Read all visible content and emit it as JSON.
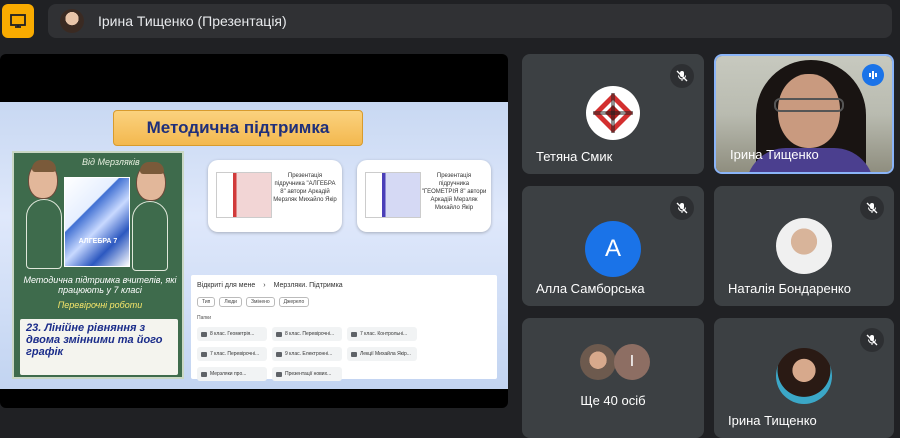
{
  "topbar": {
    "title": "Ірина Тищенко (Презентація)"
  },
  "slide": {
    "title": "Методична підтримка",
    "board_from": "Від Мерзляків",
    "book_label": "АЛГЕБРА 7",
    "board_text": "Методична підтримка вчителів, які працюють у 7 класі",
    "board_sub": "Перевірочні роботи",
    "note_text": "23. Лінійне рівняння з двома змінними та його графік",
    "card1_text": "Презентація підручника \"АЛГЕБРА 8\" автори Аркадій Мерзляк Михайло Якір",
    "card2_text": "Презентація підручника \"ГЕОМЕТРІЯ 8\" автори Аркадій Мерзляк Михайло Якір",
    "drive": {
      "shared": "Відкриті для мене",
      "folder": "Мерзляки. Підтримка",
      "chips": [
        "Тип",
        "Люди",
        "Змінено",
        "Джерело"
      ],
      "label": "Папки",
      "files": [
        "8 клас. Геометрія...",
        "8 клас. Перевірочні...",
        "7 клас. Контрольні...",
        "7 клас. Перевірочні...",
        "9 клас. Електронні...",
        "Лекції Михайла Якір...",
        "Мерзляки про...",
        "Презентації нових..."
      ]
    }
  },
  "participants": [
    {
      "name": "Тетяна Смик",
      "muted": true
    },
    {
      "name": "Ірина Тищенко",
      "speaking": true
    },
    {
      "name": "Алла Самборська",
      "initial": "А",
      "muted": true
    },
    {
      "name": "Наталія Бондаренко",
      "muted": true
    },
    {
      "name": "Ще 40 осіб",
      "extra_initial": "І"
    },
    {
      "name": "Ірина Тищенко",
      "muted": true
    }
  ],
  "colors": {
    "background": "#202124",
    "tile": "#3c4043",
    "accent": "#f9ab00",
    "avatar_blue": "#1a73e8",
    "avatar_brown": "#8d6e63",
    "active_border": "#8ab4f8"
  },
  "icons": {
    "app": "presentation-icon",
    "mute": "mic-off-icon",
    "speaking": "audio-level-icon"
  }
}
